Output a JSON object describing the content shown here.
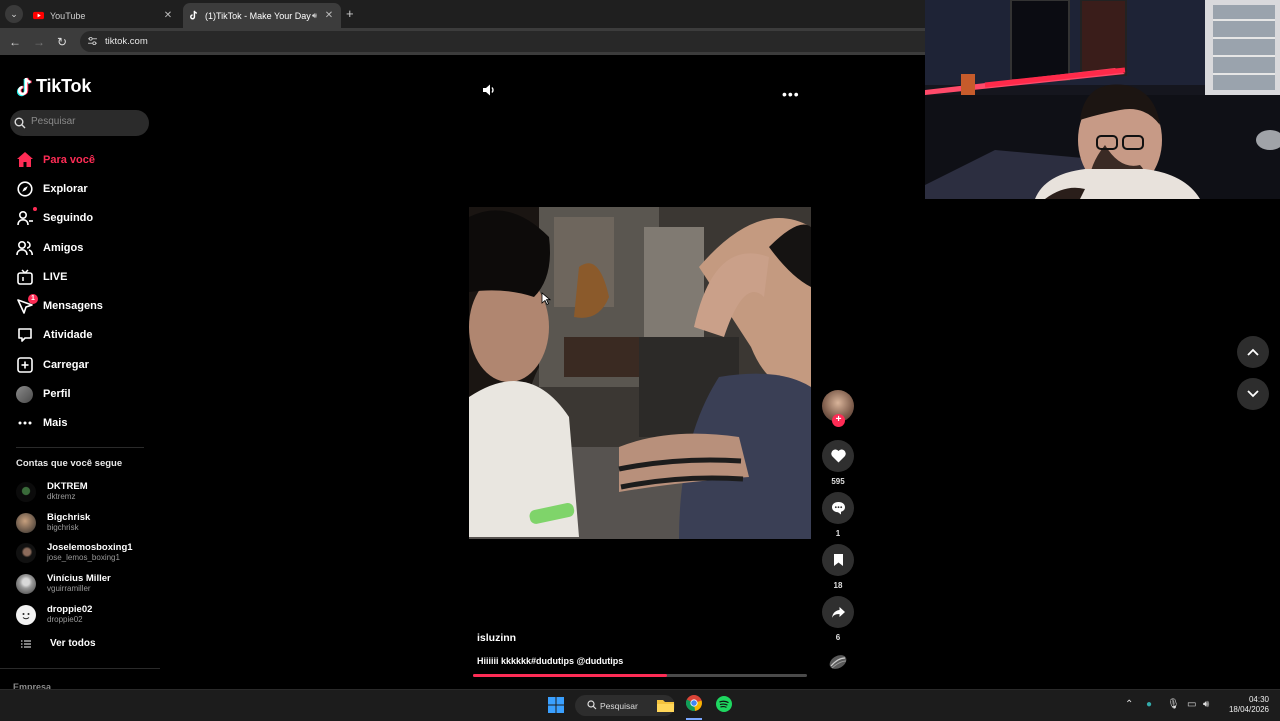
{
  "browser": {
    "tabs": [
      {
        "title": "YouTube",
        "icon": "youtube-icon",
        "active": false
      },
      {
        "title": "(1)TikTok - Make Your Day",
        "icon": "tiktok-icon",
        "active": true,
        "audio": true
      }
    ],
    "url": "tiktok.com"
  },
  "brand": {
    "name": "TikTok",
    "accent": "#fe2c55"
  },
  "search": {
    "placeholder": "Pesquisar"
  },
  "nav": [
    {
      "label": "Para você",
      "icon": "home-icon",
      "active": true
    },
    {
      "label": "Explorar",
      "icon": "compass-icon"
    },
    {
      "label": "Seguindo",
      "icon": "following-icon",
      "dot": true
    },
    {
      "label": "Amigos",
      "icon": "friends-icon"
    },
    {
      "label": "LIVE",
      "icon": "live-icon"
    },
    {
      "label": "Mensagens",
      "icon": "messages-icon",
      "badge": "1"
    },
    {
      "label": "Atividade",
      "icon": "activity-icon"
    },
    {
      "label": "Carregar",
      "icon": "upload-icon"
    },
    {
      "label": "Perfil",
      "icon": "profile-avatar"
    },
    {
      "label": "Mais",
      "icon": "more-icon"
    }
  ],
  "following": {
    "heading": "Contas que você segue",
    "accounts": [
      {
        "name": "DKTREM",
        "handle": "dktremz"
      },
      {
        "name": "Bigchrisk",
        "handle": "bigchrisk"
      },
      {
        "name": "Joselemosboxing1",
        "handle": "jose_lemos_boxing1"
      },
      {
        "name": "Vinícius Miller",
        "handle": "vguirramiller"
      },
      {
        "name": "droppie02",
        "handle": "droppie02"
      }
    ],
    "see_all": "Ver todos"
  },
  "footer": {
    "empresa": "Empresa"
  },
  "video": {
    "author": "isluzinn",
    "caption": "Hiiiiii kkkkkk#dudutips @dudutips",
    "progress": 0.58
  },
  "actions": {
    "likes": "595",
    "comments": "1",
    "saves": "18",
    "shares": "6"
  },
  "taskbar": {
    "search_label": "Pesquisar",
    "time": "04:30",
    "date": "18/04/2026"
  }
}
